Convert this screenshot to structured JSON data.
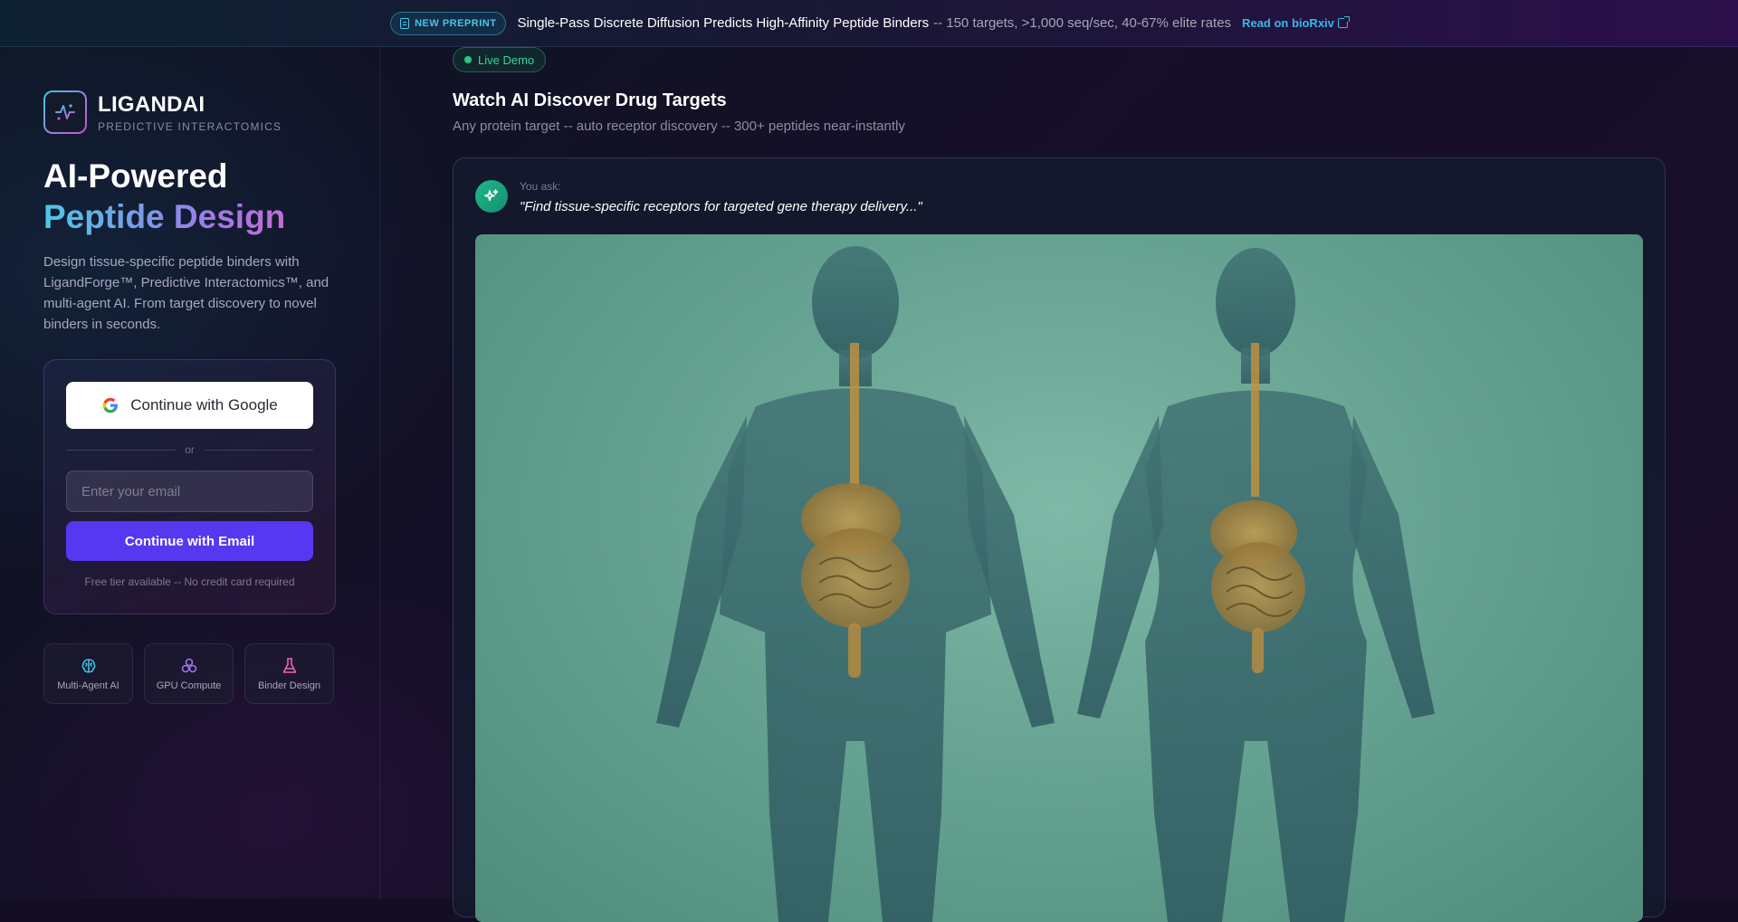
{
  "banner": {
    "pill_label": "NEW PREPRINT",
    "headline": "Single-Pass Discrete Diffusion Predicts High-Affinity Peptide Binders",
    "subtext": "-- 150 targets, >1,000 seq/sec, 40-67% elite rates",
    "link_label": "Read on bioRxiv"
  },
  "brand": {
    "name": "LIGANDAI",
    "tagline": "PREDICTIVE INTERACTOMICS"
  },
  "hero": {
    "line1": "AI-Powered",
    "line2": "Peptide Design",
    "description": "Design tissue-specific peptide binders with LigandForge™, Predictive Interactomics™, and multi-agent AI. From target discovery to novel binders in seconds."
  },
  "auth": {
    "google_label": "Continue with Google",
    "divider_label": "or",
    "email_placeholder": "Enter your email",
    "email_button_label": "Continue with Email",
    "footnote": "Free tier available -- No credit card required"
  },
  "features": [
    {
      "label": "Multi-Agent AI",
      "icon": "brain-icon",
      "color": "#3cc0e0"
    },
    {
      "label": "GPU Compute",
      "icon": "cluster-icon",
      "color": "#a070e8"
    },
    {
      "label": "Binder Design",
      "icon": "flask-icon",
      "color": "#e860b8"
    }
  ],
  "demo": {
    "live_label": "Live Demo",
    "title": "Watch AI Discover Drug Targets",
    "subtitle": "Any protein target -- auto receptor discovery -- 300+ peptides near-instantly",
    "ask_label": "You ask:",
    "ask_query": "\"Find tissue-specific receptors for targeted gene therapy delivery...\""
  },
  "colors": {
    "accent": "#5538f0",
    "live_green": "#2fc47f",
    "link_cyan": "#38b8e8"
  }
}
